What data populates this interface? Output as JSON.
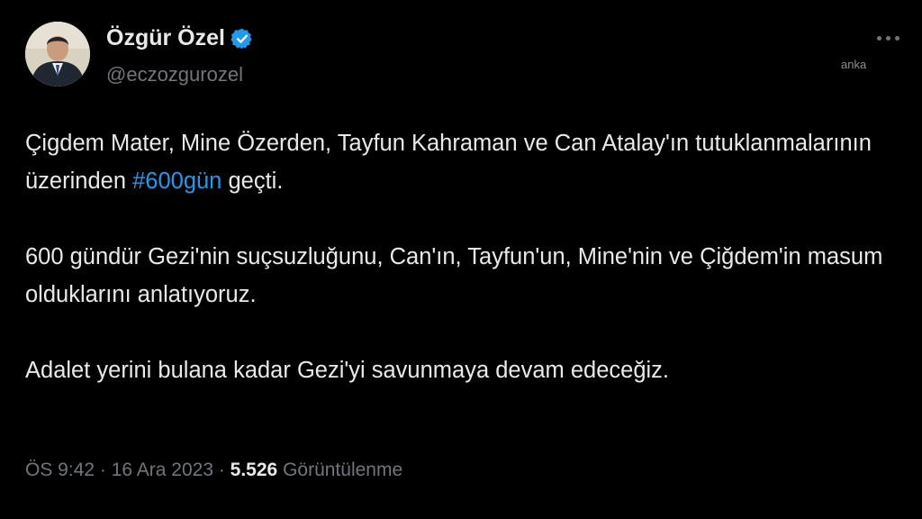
{
  "author": {
    "name": "Özgür Özel",
    "handle": "@eczozgurozel",
    "verified": true,
    "verified_color": "#1d9bf0"
  },
  "watermark": "anka",
  "tweet": {
    "p1_before": "Çigdem Mater, Mine Özerden, Tayfun Kahraman ve Can Atalay'ın tutuklanmalarının üzerinden ",
    "hashtag": "#600gün",
    "p1_after": " geçti.",
    "p2": "600 gündür Gezi'nin suçsuzluğunu, Can'ın, Tayfun'un, Mine'nin ve Çiğdem'in masum olduklarını anlatıyoruz.",
    "p3": "Adalet yerini bulana kadar Gezi'yi savunmaya devam edeceğiz."
  },
  "meta": {
    "time": "ÖS 9:42",
    "separator": " · ",
    "date": "16 Ara 2023",
    "views_count": "5.526",
    "views_label": " Görüntülenme"
  },
  "icons": {
    "avatar": "profile-photo",
    "verified": "verified-badge-icon",
    "more": "more-options-icon"
  },
  "colors": {
    "background": "#000000",
    "text": "#e7e9ea",
    "secondary": "#71767b",
    "link": "#1d9bf0"
  }
}
